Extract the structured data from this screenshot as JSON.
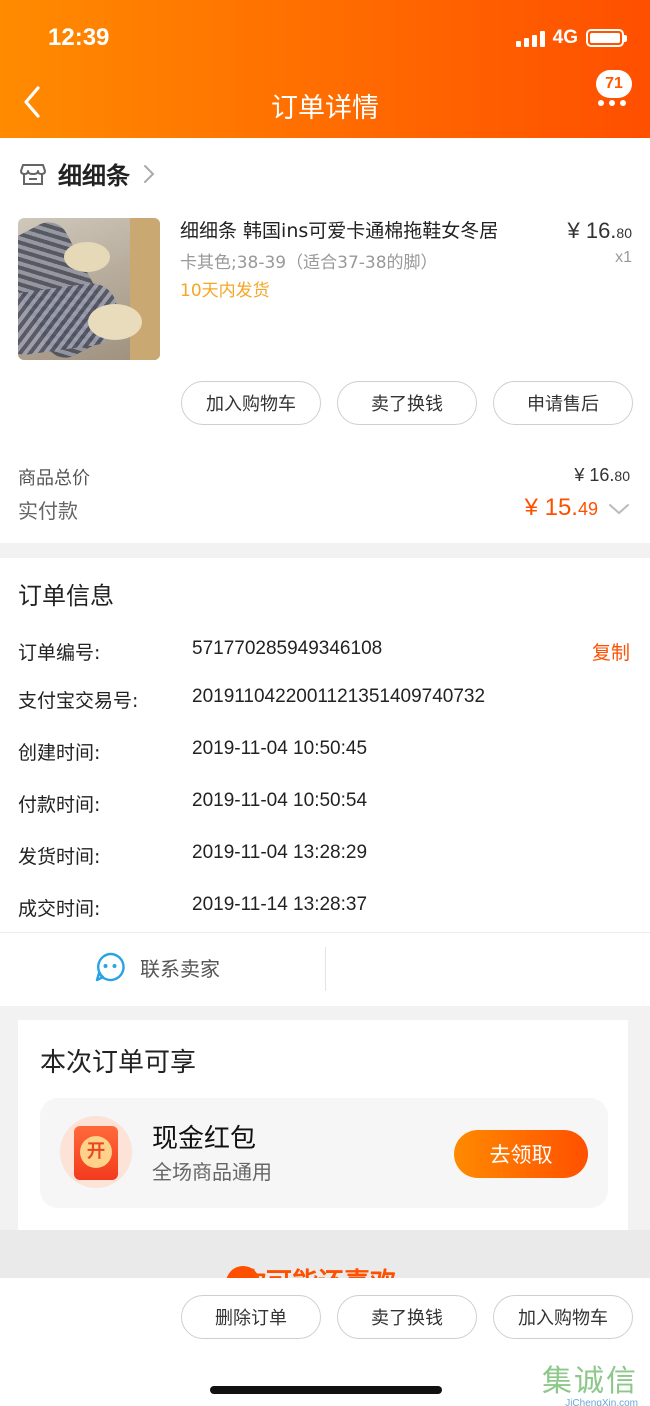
{
  "status_bar": {
    "time": "12:39",
    "network": "4G"
  },
  "header": {
    "title": "订单详情",
    "badge_count": "71"
  },
  "shop": {
    "name": "细细条"
  },
  "product": {
    "title": "细细条 韩国ins可爱卡通棉拖鞋女冬居",
    "variant": "卡其色;38-39（适合37-38的脚）",
    "shipping": "10天内发货",
    "price_int": "¥ 16.",
    "price_dec": "80",
    "qty": "x1"
  },
  "item_actions": [
    "加入购物车",
    "卖了换钱",
    "申请售后"
  ],
  "summary": {
    "total_label": "商品总价",
    "total_int": "¥ 16.",
    "total_dec": "80",
    "paid_label": "实付款",
    "paid_int": "¥ 15.",
    "paid_dec": "49"
  },
  "order_info": {
    "title": "订单信息",
    "copy_label": "复制",
    "rows": [
      {
        "label": "订单编号:",
        "value": "571770285949346108"
      },
      {
        "label": "支付宝交易号:",
        "value": "2019110422001121351409740732"
      },
      {
        "label": "创建时间:",
        "value": "2019-11-04 10:50:45"
      },
      {
        "label": "付款时间:",
        "value": "2019-11-04 10:50:54"
      },
      {
        "label": "发货时间:",
        "value": "2019-11-04 13:28:29"
      },
      {
        "label": "成交时间:",
        "value": "2019-11-14 13:28:37"
      }
    ]
  },
  "contact": {
    "label": "联系卖家"
  },
  "promo": {
    "title": "本次订单可享",
    "coupon_icon_text": "开",
    "coupon_title": "现金红包",
    "coupon_sub": "全场商品通用",
    "claim_label": "去领取"
  },
  "recommend": {
    "label": "你可能还喜欢"
  },
  "bottom_actions": [
    "删除订单",
    "卖了换钱",
    "加入购物车"
  ],
  "watermark": {
    "main": "集诚信",
    "sub": "JiChengXin.com"
  },
  "colors": {
    "accent": "#ff5000",
    "header_start": "#ff8b00",
    "header_end": "#ff4f00",
    "ship": "#f5a623"
  }
}
